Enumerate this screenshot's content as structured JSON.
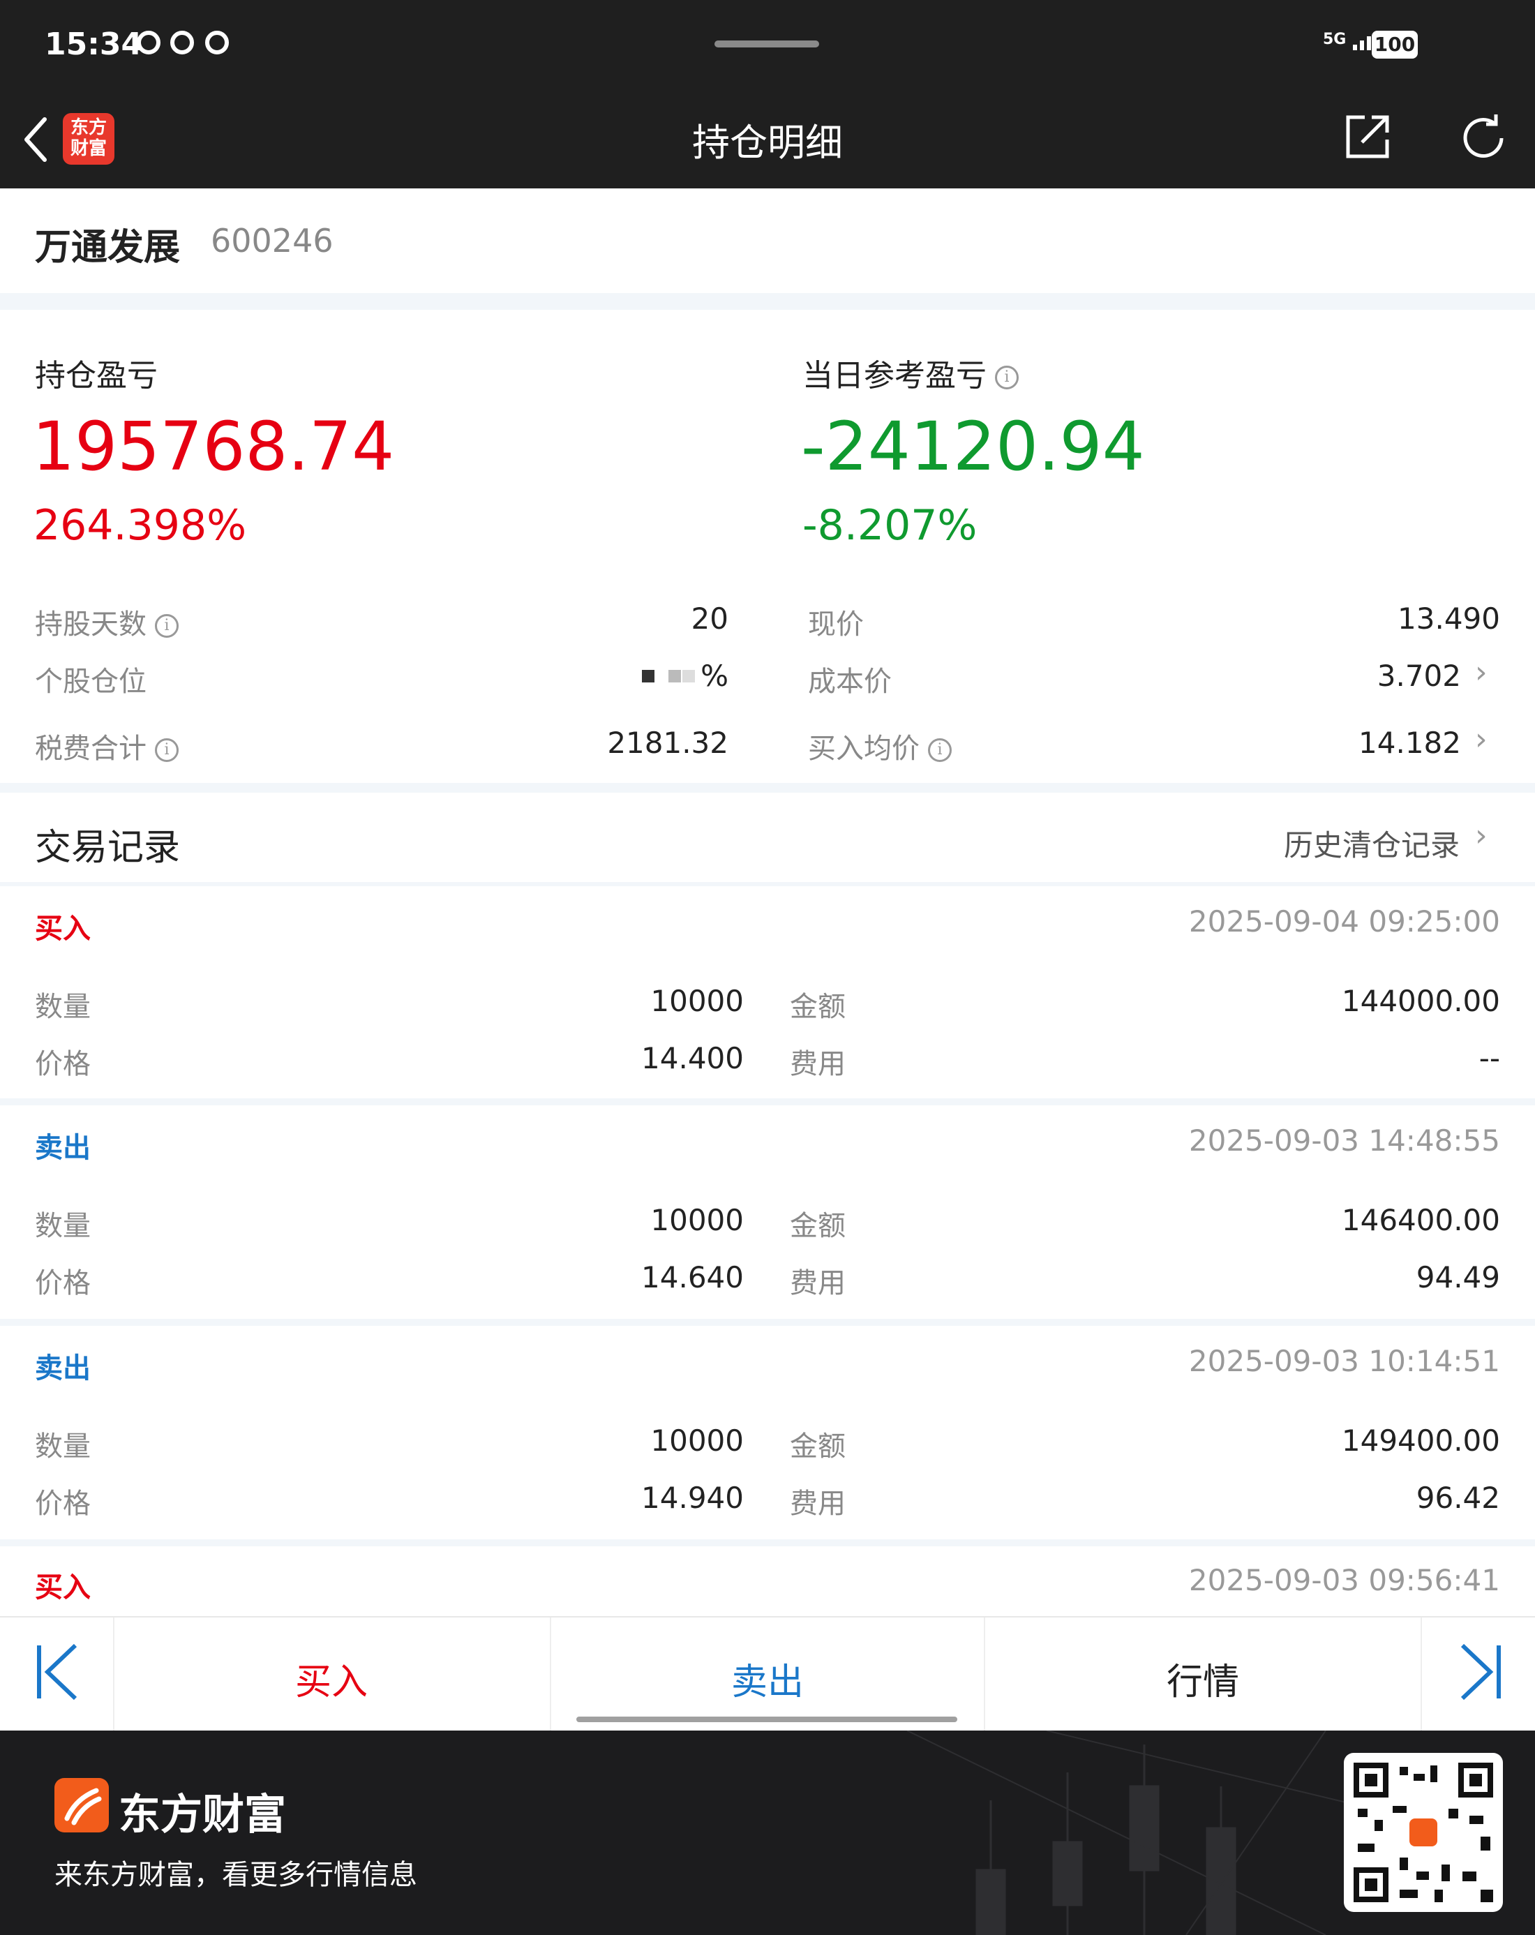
{
  "status": {
    "time": "15:34",
    "network": "5G",
    "battery": "100"
  },
  "nav": {
    "title": "持仓明细",
    "logo_text": "东方财富"
  },
  "stock": {
    "name": "万通发展",
    "code": "600246"
  },
  "holding_pl": {
    "label": "持仓盈亏",
    "value": "195768.74",
    "pct": "264.398%"
  },
  "daily_pl": {
    "label": "当日参考盈亏",
    "value": "-24120.94",
    "pct": "-8.207%"
  },
  "details": {
    "left": [
      {
        "label": "持股天数",
        "value": "20"
      },
      {
        "label": "个股仓位",
        "value": "%"
      },
      {
        "label": "税费合计",
        "value": "2181.32"
      }
    ],
    "right": [
      {
        "label": "现价",
        "value": "13.490"
      },
      {
        "label": "成本价",
        "value": "3.702"
      },
      {
        "label": "买入均价",
        "value": "14.182"
      }
    ]
  },
  "records_section": {
    "title": "交易记录",
    "history_link": "历史清仓记录"
  },
  "records": [
    {
      "type": "买入",
      "time": "2025-09-04 09:25:00",
      "qty_label": "数量",
      "qty": "10000",
      "amt_label": "金额",
      "amount": "144000.00",
      "price_label": "价格",
      "price": "14.400",
      "fee_label": "费用",
      "fee": "--"
    },
    {
      "type": "卖出",
      "time": "2025-09-03 14:48:55",
      "qty_label": "数量",
      "qty": "10000",
      "amt_label": "金额",
      "amount": "146400.00",
      "price_label": "价格",
      "price": "14.640",
      "fee_label": "费用",
      "fee": "94.49"
    },
    {
      "type": "卖出",
      "time": "2025-09-03 10:14:51",
      "qty_label": "数量",
      "qty": "10000",
      "amt_label": "金额",
      "amount": "149400.00",
      "price_label": "价格",
      "price": "14.940",
      "fee_label": "费用",
      "fee": "96.42"
    },
    {
      "type": "买入",
      "time": "2025-09-03 09:56:41"
    }
  ],
  "tabs": {
    "buy": "买入",
    "sell": "卖出",
    "market": "行情"
  },
  "footer": {
    "brand": "东方财富",
    "slogan": "来东方财富，看更多行情信息"
  },
  "colors": {
    "red": "#e60012",
    "green": "#0f9a2f",
    "blue": "#1a77c9",
    "dark": "#1f1f1f"
  }
}
